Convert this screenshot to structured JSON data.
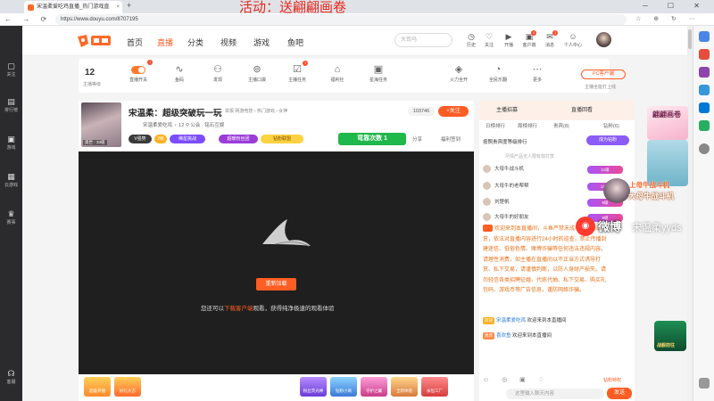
{
  "browser": {
    "tab_title": "宋温柔爱吃鸡直播_热门游戏直",
    "tab_close": "×",
    "new_tab": "+",
    "url": "https://www.douyu.com/8707195",
    "window_controls": "─ ☐ ✕",
    "nav_buttons": "← → ⟳",
    "toolbar_icons": "☆ ⊕ ↻ ⋯"
  },
  "overlay": {
    "activity": "活动：送翩翩画卷"
  },
  "left_nav": [
    {
      "icon": "▢",
      "label": "关注"
    },
    {
      "icon": "▤",
      "label": "排行榜"
    },
    {
      "icon": "▣",
      "label": "游戏"
    },
    {
      "icon": "▦",
      "label": "云游戏"
    },
    {
      "icon": "♛",
      "label": "赛事"
    },
    {
      "icon": "☊",
      "label": "客服"
    }
  ],
  "header": {
    "nav": [
      "首页",
      "直播",
      "分类",
      "视频",
      "游戏",
      "鱼吧"
    ],
    "search_placeholder": "大司马",
    "icons": [
      {
        "glyph": "◷",
        "label": "历史"
      },
      {
        "glyph": "♡",
        "label": "关注"
      },
      {
        "glyph": "▶",
        "label": "开播"
      },
      {
        "glyph": "▣",
        "label": "客户端"
      },
      {
        "glyph": "✉",
        "label": "消息"
      },
      {
        "glyph": "☺",
        "label": "个人中心"
      }
    ],
    "badge_client": "4",
    "badge_msg": "1"
  },
  "toolbar": {
    "level": "12",
    "level_caption": "主播等级",
    "toggle_badge": "1",
    "task_badge": "1",
    "items": [
      {
        "glyph": "",
        "label": "直播开关"
      },
      {
        "glyph": "∿",
        "label": "鱼码"
      },
      {
        "glyph": "⚇",
        "label": "发现"
      },
      {
        "glyph": "⊚",
        "label": "主播口袋"
      },
      {
        "glyph": "☑",
        "label": "主播任务"
      },
      {
        "glyph": "⌂",
        "label": "福利社"
      },
      {
        "glyph": "▣",
        "label": "星海任务"
      },
      {
        "glyph": "◈",
        "label": "火力全开"
      },
      {
        "glyph": "◔",
        "label": "全民乐翻"
      },
      {
        "glyph": "⋯",
        "label": "更多"
      }
    ],
    "pc_client": "PC客户端",
    "pc_sub": "主播全能打上线"
  },
  "room": {
    "title": "宋温柔：超级突破玩一玩",
    "tags": "举报  网游竞技 › 热门游戏 › 女神",
    "anchor": "宋温柔爱吃鸡  ♀ 12  ⚲ 公会 · 铭石互娱",
    "avatar_caption": "奥世 · 33级",
    "room_id": "103746",
    "follow": "+关注",
    "pills": [
      "V强势",
      "2级",
      "稀星挑战",
      "超暖粉丝团",
      "钻粉联盟"
    ],
    "flag_event": "弯靠次数 1",
    "share": "分享",
    "report": "福利签到"
  },
  "player": {
    "reload": "重新加载",
    "msg_prefix": "您还可以",
    "msg_link": "下载客户端",
    "msg_suffix": "观看，获得纯净极速的观看体验"
  },
  "gifts_left": [
    "超级开播",
    "好礼大方"
  ],
  "gifts_right": [
    "粉丝荧光棒",
    "钻粉小窝",
    "守护之翼",
    "全新体验",
    "永恒工厂"
  ],
  "right_panel": {
    "tabs": [
      "主播招募",
      "直播回看"
    ],
    "subtabs": [
      "日榜排行",
      "周榜排行",
      "贵宾(8)",
      "钻粉(6)"
    ],
    "rank_title": "按照贵宾度等级排行",
    "rank_button": "成为钻粉",
    "rank_note": "尽情产品无人限有效打赏",
    "rank": [
      {
        "name": "大母牛战斗机",
        "level": "11级"
      },
      {
        "name": "大母牛的老帮帮",
        "level": "10级"
      },
      {
        "name": "刘楚帆",
        "level": "9级"
      },
      {
        "name": "大母牛的好朋友",
        "level": "8级"
      }
    ],
    "welcome": "欢迎来到本直播间，斗鱼严禁未成年人直播或打赏，依法对直播内容进行24小时的巡查，禁止传播封建迷信、低俗色情、赌博诈骗等任何违法违规内容。请理性消费，如主播在直播间以不正当方式诱导打赏、私下交易，请谨慎判断，以防人身财产损失。请勿轻信各类招聘征婚、代练代抽、私下交易、购买礼包码、游戏币等广告信息，谨防网络诈骗。",
    "chat": [
      {
        "badge": "欢迎",
        "user": "宋温柔爱吃鸡",
        "text": "欢迎来到本直播间"
      },
      {
        "badge": "贵宾",
        "user": "喜欢鱼",
        "text": "欢迎来到本直播间"
      }
    ],
    "chat_icons": "☺ ◎ ▣ ♢",
    "fan_link": "钻粉特权",
    "input_placeholder": "这里输入聊天内容",
    "send": "发送"
  },
  "ads": {
    "top_title": "翩翩画卷",
    "label1": "上母牛战斗机",
    "label2": "大母牛战斗机",
    "weibo_text": "微博",
    "weibo_id": "宋温柔yyds",
    "bottom": "战舰前往"
  },
  "colors": {
    "accent": "#ff5d23",
    "sidebar": "#2b2b2e",
    "player": "#1f1f1f"
  }
}
